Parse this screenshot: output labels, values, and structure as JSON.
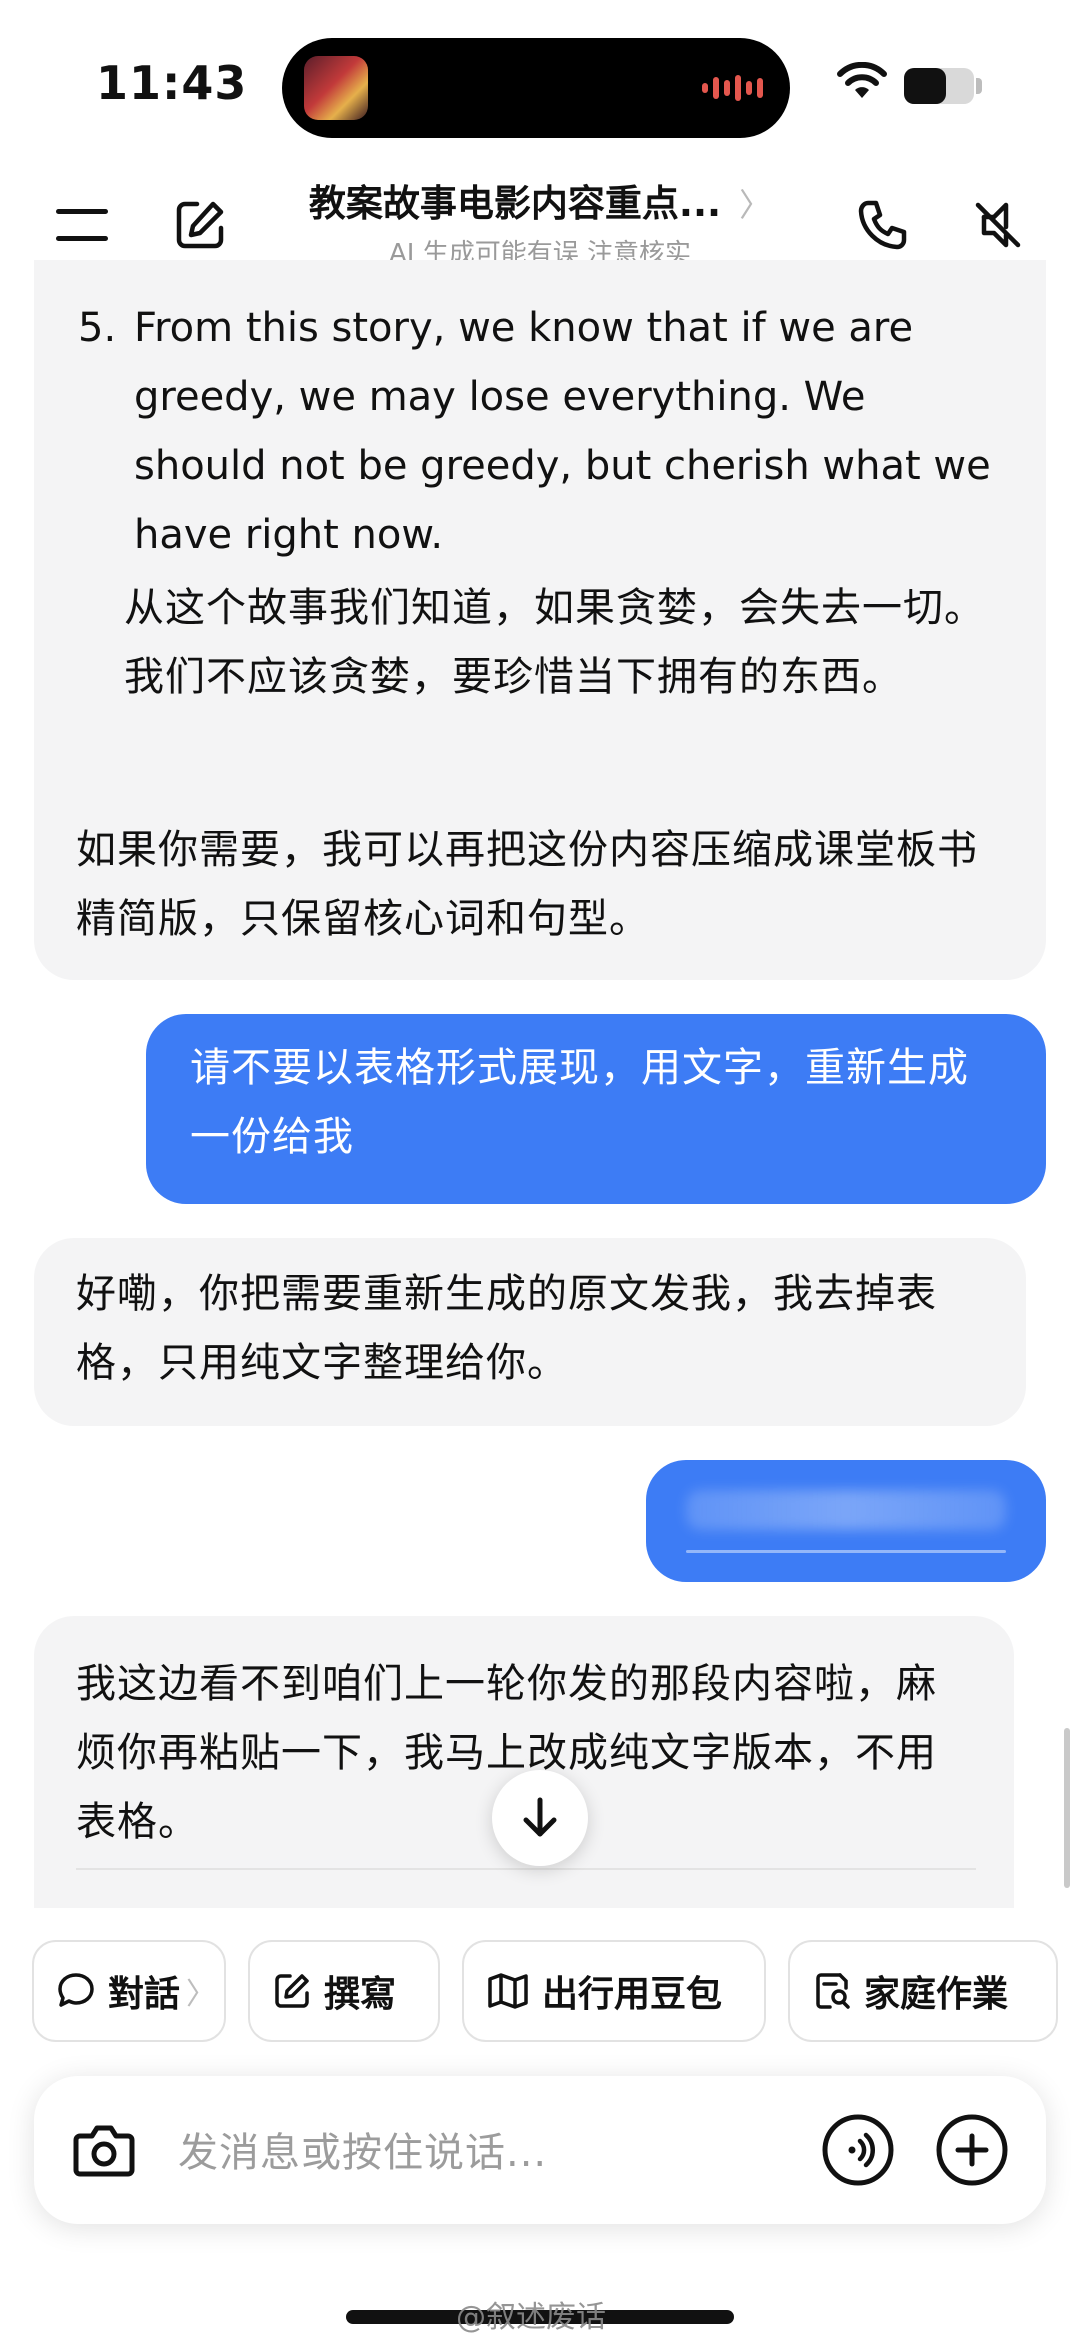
{
  "status_bar": {
    "time": "11:43"
  },
  "nav": {
    "title": "教案故事电影内容重点...",
    "chevron": "〉",
    "subtitle": "AI 生成可能有误 注意核实"
  },
  "messages": {
    "ai1": {
      "list_number": "5.",
      "english": "From this story, we know that if we are greedy, we may lose everything. We should not be greedy, but cherish what we have right now.",
      "chinese": "从这个故事我们知道，如果贪婪，会失去一切。我们不应该贪婪，要珍惜当下拥有的东西。",
      "follow_up": "如果你需要，我可以再把这份内容压缩成课堂板书精简版，只保留核心词和句型。"
    },
    "user1": "请不要以表格形式展现，用文字，重新生成一份给我",
    "ai2": "好嘞，你把需要重新生成的原文发我，我去掉表格，只用纯文字整理给你。",
    "ai3": "我这边看不到咱们上一轮你发的那段内容啦，麻烦你再粘贴一下，我马上改成纯文字版本，不用表格。"
  },
  "chips": [
    {
      "label": "對話",
      "icon": "chat-bubble-icon",
      "arrow": "〉"
    },
    {
      "label": "撰寫",
      "icon": "edit-icon"
    },
    {
      "label": "出行用豆包",
      "icon": "map-icon"
    },
    {
      "label": "家庭作業",
      "icon": "homework-icon"
    }
  ],
  "input": {
    "placeholder": "发消息或按住说话..."
  },
  "watermark": "@叙述废话",
  "colors": {
    "user_bubble": "#3d7cf5",
    "ai_bubble": "#f4f4f5"
  }
}
